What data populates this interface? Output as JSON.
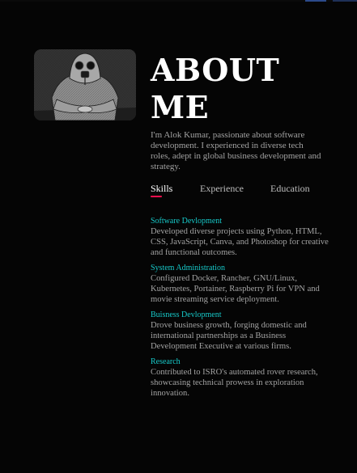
{
  "about": {
    "title": "ABOUT ME",
    "intro": "I'm Alok Kumar, passionate about software development. I experienced in diverse tech roles, adept in global business development and strategy."
  },
  "tabs": [
    {
      "label": "Skills",
      "active": true
    },
    {
      "label": "Experience",
      "active": false
    },
    {
      "label": "Education",
      "active": false
    }
  ],
  "skills": [
    {
      "name": "Software Devlopment",
      "description": "Developed diverse projects using Python, HTML, CSS, JavaScript, Canva, and Photoshop for creative and functional outcomes."
    },
    {
      "name": "System Administration",
      "description": "Configured Docker, Rancher, GNU/Linux, Kubernetes, Portainer, Raspberry Pi for VPN and movie streaming service deployment."
    },
    {
      "name": "Buisness Devlopment",
      "description": "Drove business growth, forging domestic and international partnerships as a Business Development Executive at various firms."
    },
    {
      "name": "Research",
      "description": "Contributed to ISRO's automated rover research, showcasing technical prowess in exploration innovation."
    }
  ],
  "colors": {
    "background": "#050505",
    "heading": "#ffffff",
    "body_text": "#a3a3a3",
    "skill_title": "#17c9c9",
    "tab_accent": "#ff0f4f"
  },
  "icons": {
    "profile_image": "gas-mask-figure-illustration"
  }
}
